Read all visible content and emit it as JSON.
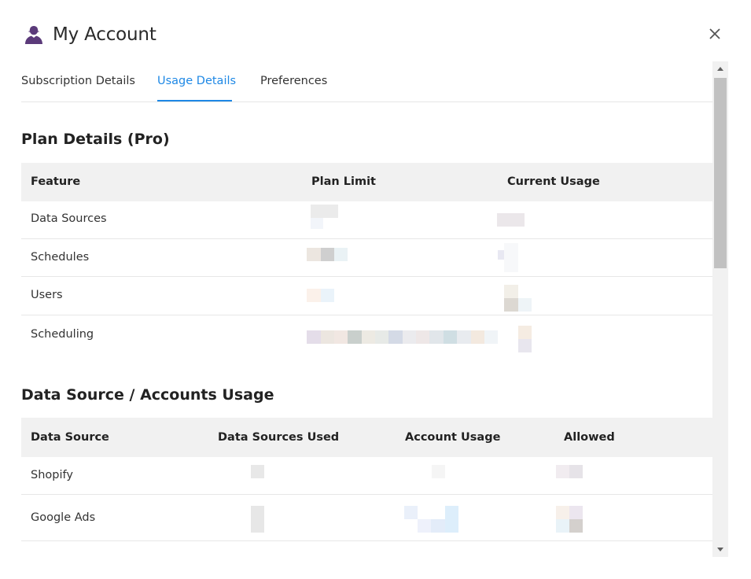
{
  "dialog": {
    "title": "My Account",
    "icon": "user-icon",
    "close_icon": "close-icon"
  },
  "tabs": [
    {
      "label": "Subscription Details",
      "active": false
    },
    {
      "label": "Usage Details",
      "active": true
    },
    {
      "label": "Preferences",
      "active": false
    }
  ],
  "plan": {
    "title": "Plan Details (Pro)",
    "headers": [
      "Feature",
      "Plan Limit",
      "Current Usage"
    ],
    "rows": [
      {
        "feature": "Data Sources"
      },
      {
        "feature": "Schedules"
      },
      {
        "feature": "Users"
      },
      {
        "feature": "Scheduling"
      }
    ]
  },
  "usage": {
    "title": "Data Source / Accounts Usage",
    "headers": [
      "Data Source",
      "Data Sources Used",
      "Account Usage",
      "Allowed"
    ],
    "rows": [
      {
        "source": "Shopify"
      },
      {
        "source": "Google Ads"
      }
    ]
  },
  "colors": {
    "accent": "#1e88e5",
    "header_bg": "#f1f1f1",
    "icon": "#5b3a7a"
  }
}
